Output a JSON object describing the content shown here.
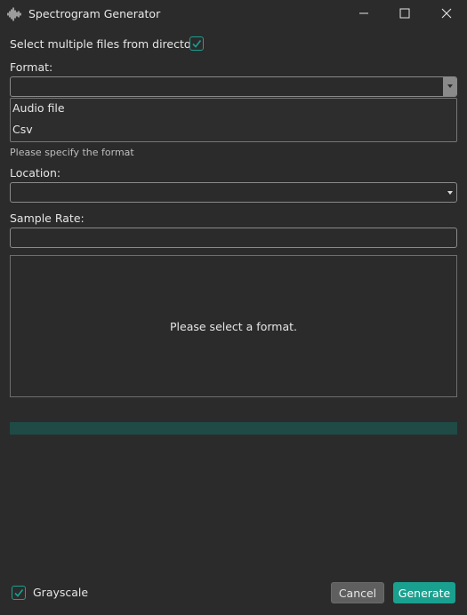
{
  "window": {
    "title": "Spectrogram Generator",
    "icon": "waveform-icon",
    "controls": [
      "minimize-icon",
      "maximize-icon",
      "close-icon"
    ]
  },
  "form": {
    "multi_select_label": "Select multiple files from directory:",
    "multi_select_checked": true,
    "format_label": "Format:",
    "format_value": "",
    "format_options": [
      "Audio file",
      "Csv"
    ],
    "format_hint": "Please specify the format",
    "location_label": "Location:",
    "location_value": "",
    "sample_rate_label": "Sample Rate:",
    "sample_rate_value": ""
  },
  "preview": {
    "message": "Please select a format."
  },
  "footer": {
    "grayscale_label": "Grayscale",
    "grayscale_checked": true,
    "cancel_label": "Cancel",
    "generate_label": "Generate"
  },
  "colors": {
    "background": "#2b2b2b",
    "accent": "#1aa08f",
    "progress_track": "#1f4a46",
    "border": "#8a8a8a"
  }
}
